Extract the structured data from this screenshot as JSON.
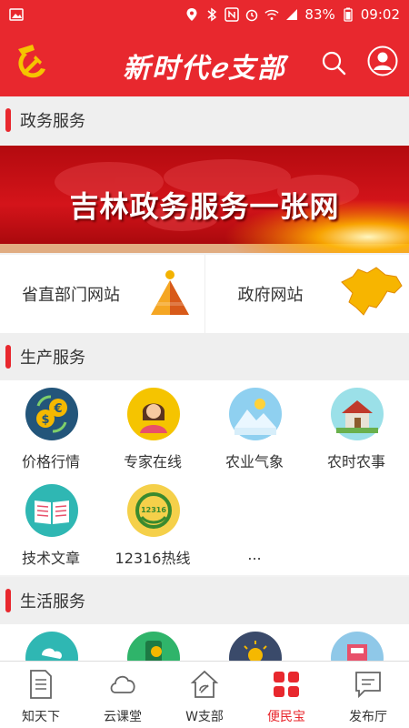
{
  "status_bar": {
    "battery": "83%",
    "time": "09:02"
  },
  "header": {
    "title": "新时代ℯ支部"
  },
  "sections": {
    "gov": {
      "title": "政务服务"
    },
    "production": {
      "title": "生产服务"
    },
    "life": {
      "title": "生活服务"
    }
  },
  "banner": {
    "text": "吉林政务服务一张网"
  },
  "links": [
    {
      "label": "省直部门网站"
    },
    {
      "label": "政府网站"
    }
  ],
  "production_items": [
    {
      "label": "价格行情",
      "icon": "price-coins-icon"
    },
    {
      "label": "专家在线",
      "icon": "expert-person-icon"
    },
    {
      "label": "农业气象",
      "icon": "weather-mountain-icon"
    },
    {
      "label": "农时农事",
      "icon": "farmhouse-icon"
    },
    {
      "label": "技术文章",
      "icon": "book-icon"
    },
    {
      "label": "12316热线",
      "icon": "hotline-12316-icon"
    },
    {
      "label": "...",
      "icon": ""
    }
  ],
  "nav": [
    {
      "label": "知天下",
      "icon": "document-icon"
    },
    {
      "label": "云课堂",
      "icon": "cloud-icon"
    },
    {
      "label": "W支部",
      "icon": "party-house-icon"
    },
    {
      "label": "便民宝",
      "icon": "grid-squares-icon",
      "active": true
    },
    {
      "label": "发布厅",
      "icon": "message-icon"
    }
  ],
  "colors": {
    "accent": "#e8282e",
    "background": "#f2f2f2"
  }
}
